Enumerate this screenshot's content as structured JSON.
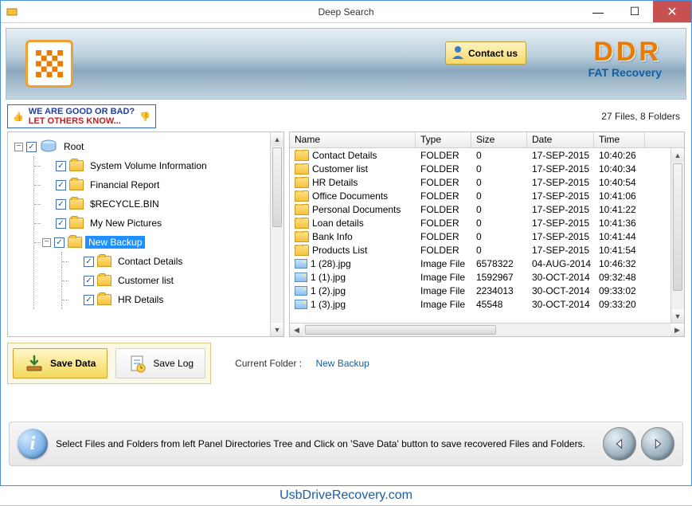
{
  "window": {
    "title": "Deep Search"
  },
  "header": {
    "contact_label": "Contact us",
    "brand": "DDR",
    "product": "FAT Recovery"
  },
  "promo": {
    "line1": "WE ARE GOOD OR BAD?",
    "line2": "LET OTHERS KNOW..."
  },
  "status": {
    "text": "27 Files, 8 Folders"
  },
  "tree": {
    "root_label": "Root",
    "items": [
      {
        "label": "System Volume Information"
      },
      {
        "label": "Financial Report"
      },
      {
        "label": "$RECYCLE.BIN"
      },
      {
        "label": "My New Pictures"
      },
      {
        "label": "New Backup",
        "selected": true,
        "expanded": true,
        "children": [
          {
            "label": "Contact Details"
          },
          {
            "label": "Customer list"
          },
          {
            "label": "HR Details"
          }
        ]
      }
    ]
  },
  "list": {
    "columns": {
      "name": "Name",
      "type": "Type",
      "size": "Size",
      "date": "Date",
      "time": "Time"
    },
    "rows": [
      {
        "icon": "folder",
        "name": "Contact Details",
        "type": "FOLDER",
        "size": "0",
        "date": "17-SEP-2015",
        "time": "10:40:26"
      },
      {
        "icon": "folder",
        "name": "Customer list",
        "type": "FOLDER",
        "size": "0",
        "date": "17-SEP-2015",
        "time": "10:40:34"
      },
      {
        "icon": "folder",
        "name": "HR Details",
        "type": "FOLDER",
        "size": "0",
        "date": "17-SEP-2015",
        "time": "10:40:54"
      },
      {
        "icon": "folder",
        "name": "Office Documents",
        "type": "FOLDER",
        "size": "0",
        "date": "17-SEP-2015",
        "time": "10:41:06"
      },
      {
        "icon": "folder",
        "name": "Personal Documents",
        "type": "FOLDER",
        "size": "0",
        "date": "17-SEP-2015",
        "time": "10:41:22"
      },
      {
        "icon": "folder",
        "name": "Loan details",
        "type": "FOLDER",
        "size": "0",
        "date": "17-SEP-2015",
        "time": "10:41:36"
      },
      {
        "icon": "folder",
        "name": "Bank Info",
        "type": "FOLDER",
        "size": "0",
        "date": "17-SEP-2015",
        "time": "10:41:44"
      },
      {
        "icon": "folder",
        "name": "Products List",
        "type": "FOLDER",
        "size": "0",
        "date": "17-SEP-2015",
        "time": "10:41:54"
      },
      {
        "icon": "image",
        "name": "1 (28).jpg",
        "type": "Image File",
        "size": "6578322",
        "date": "04-AUG-2014",
        "time": "10:46:32"
      },
      {
        "icon": "image",
        "name": "1 (1).jpg",
        "type": "Image File",
        "size": "1592967",
        "date": "30-OCT-2014",
        "time": "09:32:48"
      },
      {
        "icon": "image",
        "name": "1 (2).jpg",
        "type": "Image File",
        "size": "2234013",
        "date": "30-OCT-2014",
        "time": "09:33:02"
      },
      {
        "icon": "image",
        "name": "1 (3).jpg",
        "type": "Image File",
        "size": "45548",
        "date": "30-OCT-2014",
        "time": "09:33:20"
      }
    ]
  },
  "actions": {
    "save_data": "Save Data",
    "save_log": "Save Log"
  },
  "current_folder": {
    "label": "Current Folder :",
    "value": "New Backup"
  },
  "hint": {
    "text": "Select Files and Folders from left Panel Directories Tree and Click on 'Save Data' button to save recovered Files and Folders."
  },
  "site": {
    "url": "UsbDriveRecovery.com"
  }
}
